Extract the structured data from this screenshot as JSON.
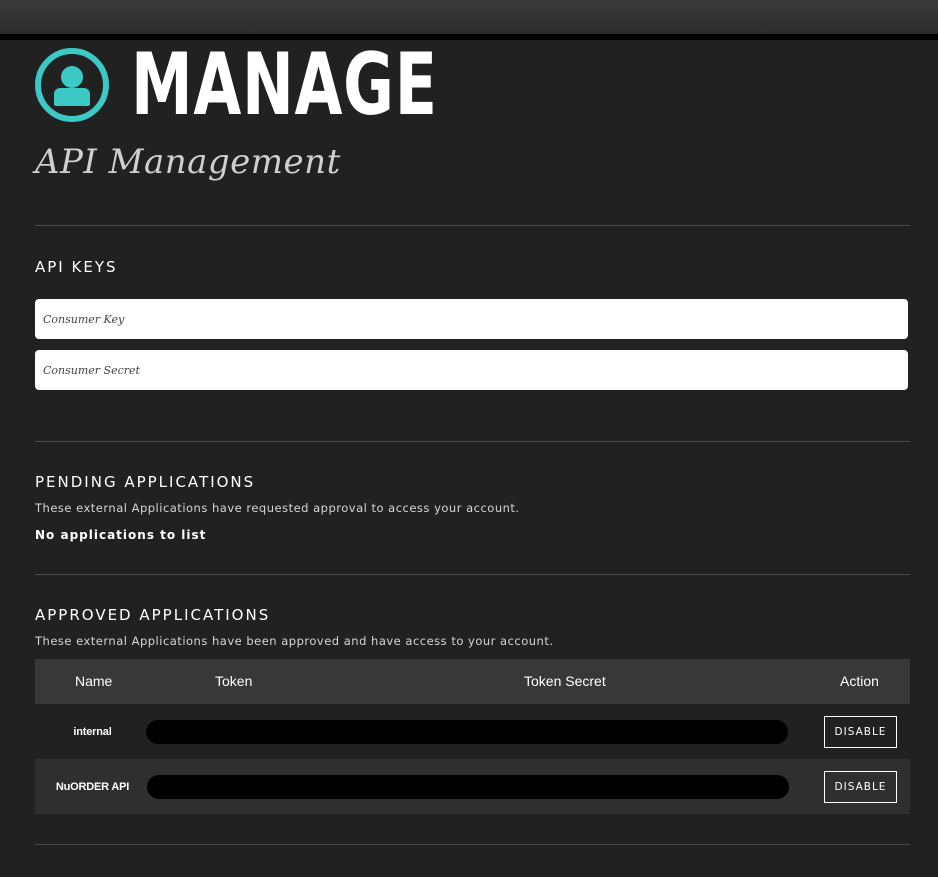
{
  "header": {
    "title": "MANAGE",
    "subtitle": "API Management",
    "accent_color": "#3cc8c4",
    "icon": "user-circle-icon"
  },
  "api_keys": {
    "heading": "API KEYS",
    "consumer_key_placeholder": "Consumer Key",
    "consumer_secret_placeholder": "Consumer Secret"
  },
  "pending": {
    "heading": "PENDING APPLICATIONS",
    "description": "These external Applications have requested approval to access your account.",
    "empty_message": "No applications to list"
  },
  "approved": {
    "heading": "APPROVED APPLICATIONS",
    "description": "These external Applications have been approved and have access to your account.",
    "columns": {
      "name": "Name",
      "token": "Token",
      "token_secret": "Token Secret",
      "action": "Action"
    },
    "rows": [
      {
        "name": "internal",
        "action_label": "DISABLE"
      },
      {
        "name": "NuORDER API",
        "action_label": "DISABLE"
      }
    ]
  }
}
